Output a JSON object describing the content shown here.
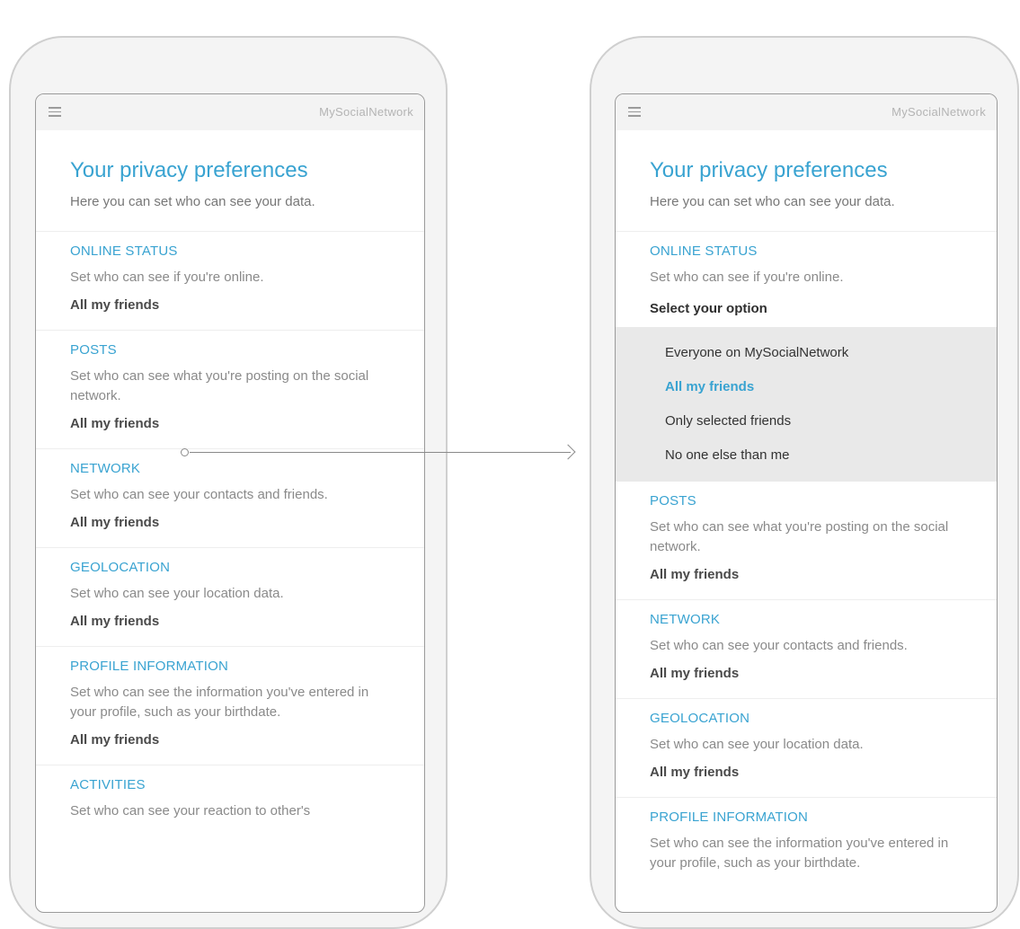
{
  "app": {
    "brand": "MySocialNetwork"
  },
  "page": {
    "title": "Your privacy preferences",
    "intro": "Here you can set who can see your data."
  },
  "sections": [
    {
      "title": "ONLINE STATUS",
      "desc": "Set who can see if you're online.",
      "value": "All my friends"
    },
    {
      "title": "POSTS",
      "desc": "Set who can see what you're posting on the social network.",
      "value": "All my friends"
    },
    {
      "title": "NETWORK",
      "desc": "Set who can see your contacts and friends.",
      "value": "All my friends"
    },
    {
      "title": "GEOLOCATION",
      "desc": "Set who can see your location data.",
      "value": "All my friends"
    },
    {
      "title": "PROFILE INFORMATION",
      "desc": "Set who can see the information you've entered in your profile, such as your birthdate.",
      "value": "All my friends"
    },
    {
      "title": "ACTIVITIES",
      "desc": "Set who can see your reaction to other's"
    }
  ],
  "dropdown": {
    "label": "Select your option",
    "options": [
      "Everyone on MySocialNetwork",
      "All my friends",
      "Only selected friends",
      "No one else than me"
    ],
    "selected": "All my friends"
  },
  "icons": {
    "menu": "hamburger-menu-icon"
  },
  "colors": {
    "accent": "#39a3d1",
    "dropdown_bg": "#e9e9e9"
  }
}
